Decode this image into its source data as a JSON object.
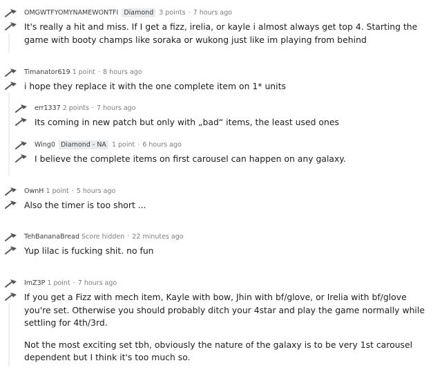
{
  "comments": [
    {
      "author": "OMGWTFYOMYNAMEWONTFI",
      "flair": "Diamond",
      "points": "3 points",
      "time": "7 hours ago",
      "paragraphs": [
        "It's really a hit and miss. If I get a fizz, irelia, or kayle i almost always get top 4. Starting the game with booty champs like soraka or wukong just like im playing from behind"
      ]
    },
    {
      "author": "Timanator619",
      "flair": "",
      "points": "1 point",
      "time": "8 hours ago",
      "paragraphs": [
        "i hope they replace it with the one complete item on 1* units"
      ]
    },
    {
      "author": "err1337",
      "flair": "",
      "points": "2 points",
      "time": "7 hours ago",
      "paragraphs": [
        "Its coming in new patch but only with „bad“ items, the least used ones"
      ]
    },
    {
      "author": "Wing0",
      "flair": "Diamond - NA",
      "points": "1 point",
      "time": "6 hours ago",
      "paragraphs": [
        "I believe the complete items on first carousel can happen on any galaxy."
      ]
    },
    {
      "author": "OwnH",
      "flair": "",
      "points": "1 point",
      "time": "5 hours ago",
      "paragraphs": [
        "Also the timer is too short ..."
      ]
    },
    {
      "author": "TehBananaBread",
      "flair": "",
      "points": "Score hidden",
      "time": "22 minutes ago",
      "paragraphs": [
        "Yup lilac is fucking shit. no fun"
      ]
    },
    {
      "author": "ImZ3P",
      "flair": "",
      "points": "1 point",
      "time": "7 hours ago",
      "paragraphs": [
        "If you get a Fizz with mech item, Kayle with bow, Jhin with bf/glove, or Irelia with bf/glove you're set. Otherwise you should probably ditch your 4star and play the game normally while settling for 4th/3rd.",
        "Not the most exciting set tbh, obviously the nature of the galaxy is to be very 1st carousel dependent but I think it's too much so."
      ]
    }
  ],
  "icons": {
    "upvote": "upvote-arrow-icon",
    "downvote": "downvote-arrow-icon"
  },
  "colors": {
    "meta": "#7c7c7c",
    "flair_bg": "#e9ebed",
    "thread_line": "#edeff1"
  }
}
